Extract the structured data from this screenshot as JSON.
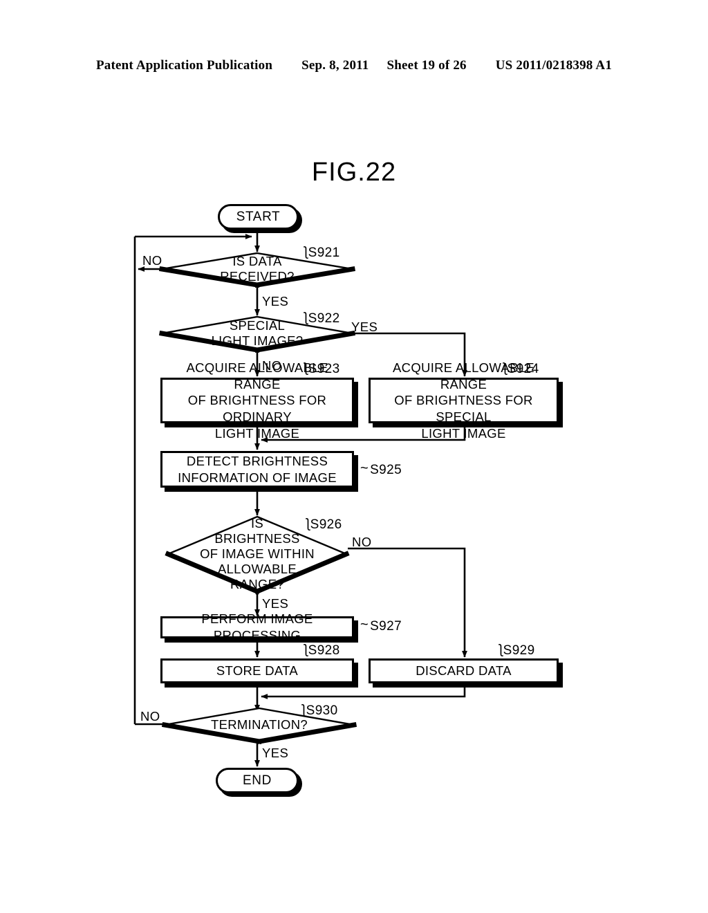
{
  "header": {
    "publication": "Patent Application Publication",
    "date": "Sep. 8, 2011",
    "sheet": "Sheet 19 of 26",
    "docnumber": "US 2011/0218398 A1"
  },
  "figure": {
    "title": "FIG.22"
  },
  "nodes": {
    "start": {
      "label": "START"
    },
    "s921": {
      "step": "S921",
      "text": "IS DATA\nRECEIVED?"
    },
    "s922": {
      "step": "S922",
      "text": "SPECIAL\nLIGHT IMAGE?"
    },
    "s923": {
      "step": "S923",
      "text": "ACQUIRE ALLOWABLE RANGE\nOF BRIGHTNESS FOR ORDINARY\nLIGHT IMAGE"
    },
    "s924": {
      "step": "S924",
      "text": "ACQUIRE ALLOWABLE RANGE\nOF BRIGHTNESS FOR SPECIAL\nLIGHT IMAGE"
    },
    "s925": {
      "step": "S925",
      "text": "DETECT BRIGHTNESS\nINFORMATION OF IMAGE"
    },
    "s926": {
      "step": "S926",
      "text": "IS\nBRIGHTNESS\nOF IMAGE WITHIN\nALLOWABLE\nRANGE?"
    },
    "s927": {
      "step": "S927",
      "text": "PERFORM IMAGE PROCESSING"
    },
    "s928": {
      "step": "S928",
      "text": "STORE DATA"
    },
    "s929": {
      "step": "S929",
      "text": "DISCARD DATA"
    },
    "s930": {
      "step": "S930",
      "text": "TERMINATION?"
    },
    "end": {
      "label": "END"
    }
  },
  "branch_labels": {
    "s921_no": "NO",
    "s921_yes": "YES",
    "s922_yes": "YES",
    "s922_no": "NO",
    "s926_no": "NO",
    "s926_yes": "YES",
    "s930_no": "NO",
    "s930_yes": "YES"
  },
  "colors": {
    "ink": "#000000",
    "paper": "#ffffff"
  }
}
